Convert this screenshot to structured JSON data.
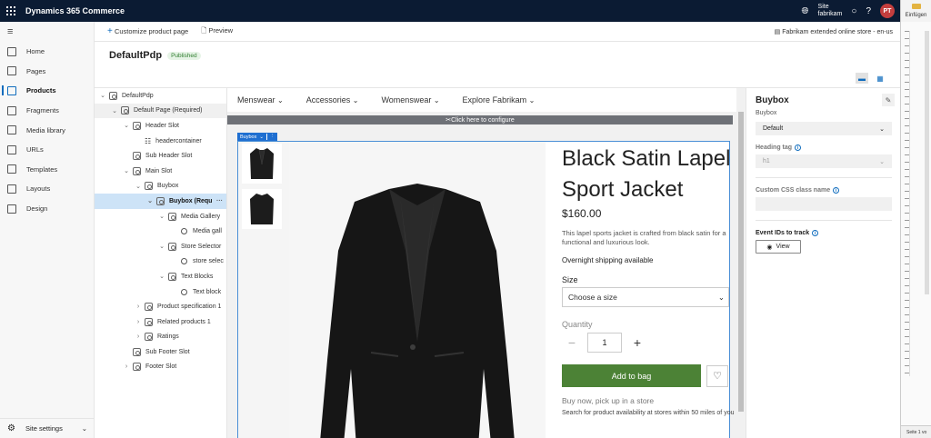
{
  "topbar": {
    "app_title": "Dynamics 365 Commerce",
    "site_label": "Site",
    "site_name": "fabrikam",
    "avatar_initials": "PT",
    "brand_color": "#0b1b33"
  },
  "office_pane": {
    "insert_label": "Einfügen",
    "page_status": "Seite 1 vo"
  },
  "nav": {
    "items": [
      {
        "label": "Home",
        "icon": "home-icon"
      },
      {
        "label": "Pages",
        "icon": "pages-icon"
      },
      {
        "label": "Products",
        "icon": "products-icon",
        "active": true
      },
      {
        "label": "Fragments",
        "icon": "fragments-icon"
      },
      {
        "label": "Media library",
        "icon": "media-icon"
      },
      {
        "label": "URLs",
        "icon": "link-icon"
      },
      {
        "label": "Templates",
        "icon": "templates-icon"
      },
      {
        "label": "Layouts",
        "icon": "layouts-icon"
      },
      {
        "label": "Design",
        "icon": "design-icon"
      }
    ],
    "site_settings": "Site settings"
  },
  "cmdbar": {
    "customize": "Customize product page",
    "preview": "Preview",
    "store": "Fabrikam extended online store - en-us"
  },
  "page": {
    "title": "DefaultPdp",
    "status": "Published"
  },
  "tree": {
    "nodes": [
      {
        "label": "DefaultPdp",
        "depth": 0,
        "chev": "⌄"
      },
      {
        "label": "Default Page (Required)",
        "depth": 1,
        "chev": "⌄",
        "state": "hl"
      },
      {
        "label": "Header Slot",
        "depth": 2,
        "chev": "⌄"
      },
      {
        "label": "headercontainer",
        "depth": 3,
        "chev": "",
        "kind": "container"
      },
      {
        "label": "Sub Header Slot",
        "depth": 2,
        "chev": ""
      },
      {
        "label": "Main Slot",
        "depth": 2,
        "chev": "⌄"
      },
      {
        "label": "Buybox",
        "depth": 3,
        "chev": "⌄"
      },
      {
        "label": "Buybox (Requ",
        "depth": 4,
        "chev": "⌄",
        "state": "sel",
        "more": "···"
      },
      {
        "label": "Media Gallery",
        "depth": 5,
        "chev": "⌄"
      },
      {
        "label": "Media gall",
        "depth": 6,
        "chev": "",
        "kind": "circle"
      },
      {
        "label": "Store Selector",
        "depth": 5,
        "chev": "⌄"
      },
      {
        "label": "store selec",
        "depth": 6,
        "chev": "",
        "kind": "circle"
      },
      {
        "label": "Text Blocks",
        "depth": 5,
        "chev": "⌄"
      },
      {
        "label": "Text block",
        "depth": 6,
        "chev": "",
        "kind": "circle"
      },
      {
        "label": "Product specification 1",
        "depth": 3,
        "chev": "›"
      },
      {
        "label": "Related products 1",
        "depth": 3,
        "chev": "›"
      },
      {
        "label": "Ratings",
        "depth": 3,
        "chev": "›"
      },
      {
        "label": "Sub Footer Slot",
        "depth": 2,
        "chev": ""
      },
      {
        "label": "Footer Slot",
        "depth": 2,
        "chev": "›"
      }
    ]
  },
  "canvas": {
    "menu": [
      "Menswear",
      "Accessories",
      "Womenswear",
      "Explore Fabrikam"
    ],
    "configure": "Click here to configure",
    "buybox_tag": "Buybox",
    "product": {
      "title": "Black Satin Lapel Sport Jacket",
      "price": "$160.00",
      "description": "This lapel sports jacket is crafted from black satin for a functional and luxurious look.",
      "shipping": "Overnight shipping available",
      "size_label": "Size",
      "size_placeholder": "Choose a size",
      "qty_label": "Quantity",
      "qty_value": "1",
      "add_to_bag": "Add to bag",
      "bopis_title": "Buy now, pick up in a store",
      "bopis_desc": "Search for product availability at stores within 50 miles of you",
      "add_color": "#4c8236"
    }
  },
  "props": {
    "title": "Buybox",
    "subtitle": "Buybox",
    "layout_value": "Default",
    "heading_label": "Heading tag",
    "heading_value": "h1",
    "css_label": "Custom CSS class name",
    "events_label": "Event IDs to track",
    "view_btn": "View"
  }
}
